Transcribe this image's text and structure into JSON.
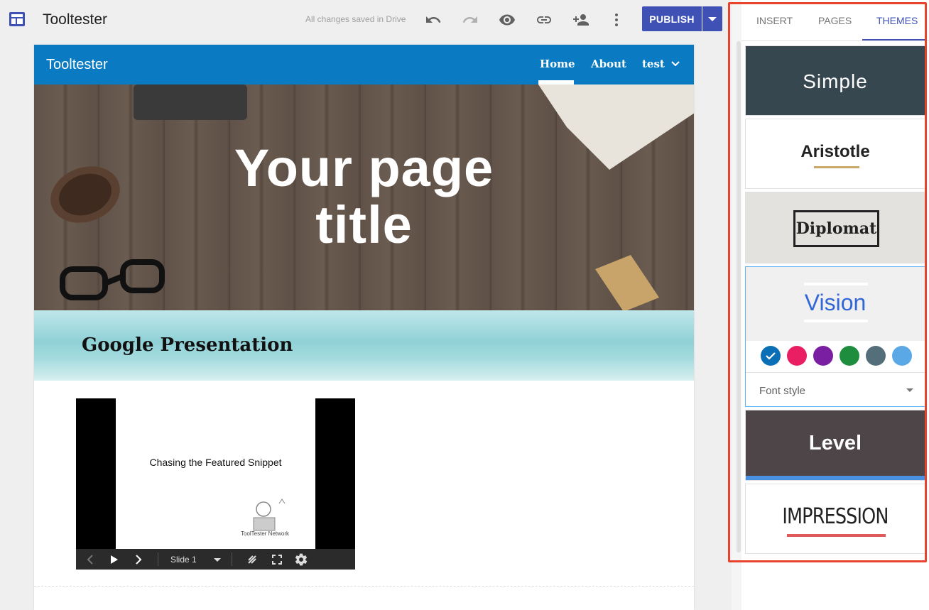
{
  "app": {
    "title": "Tooltester",
    "save_status": "All changes saved in Drive"
  },
  "toolbar": {
    "undo_icon": "undo-icon",
    "redo_icon": "redo-icon",
    "preview_icon": "eye-icon",
    "link_icon": "link-icon",
    "share_icon": "add-person-icon",
    "more_icon": "more-vert-icon",
    "publish_label": "PUBLISH"
  },
  "site": {
    "brand": "Tooltester",
    "nav": [
      {
        "label": "Home"
      },
      {
        "label": "About"
      },
      {
        "label": "test"
      }
    ],
    "hero_title_line1": "Your page",
    "hero_title_line2": "title",
    "section_title": "Google Presentation",
    "presentation": {
      "slide_text": "Chasing the Featured Snippet",
      "slide_logo_text": "ToolTester Network",
      "slide_selector": "Slide 1"
    }
  },
  "panel": {
    "tabs": [
      {
        "label": "INSERT"
      },
      {
        "label": "PAGES"
      },
      {
        "label": "THEMES"
      }
    ],
    "active_tab": "THEMES",
    "themes": [
      {
        "name": "Simple"
      },
      {
        "name": "Aristotle"
      },
      {
        "name": "Diplomat"
      },
      {
        "name": "Vision"
      },
      {
        "name": "Level"
      },
      {
        "name": "IMPRESSION"
      }
    ],
    "selected_theme": "Vision",
    "vision_colors": [
      "#0a6fb5",
      "#e91e63",
      "#7b1fa2",
      "#1e8e3e",
      "#546e7a",
      "#5aa9e6"
    ],
    "selected_color_index": 0,
    "font_style_label": "Font style"
  },
  "colors": {
    "accent": "#3f51b5",
    "site_nav": "#0a7bc2",
    "highlight": "#e8432d"
  }
}
